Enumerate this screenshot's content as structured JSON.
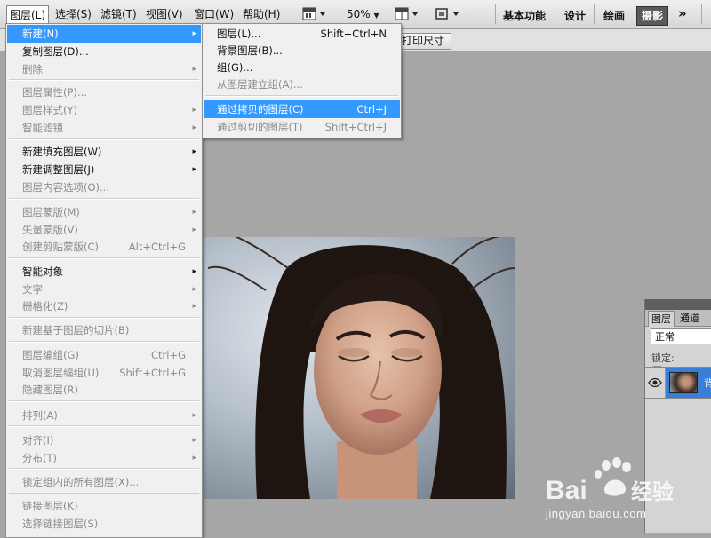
{
  "menubar": {
    "items": [
      "图层(L)",
      "选择(S)",
      "滤镜(T)",
      "视图(V)",
      "窗口(W)",
      "帮助(H)"
    ],
    "zoom": "50%",
    "workspaces": [
      "基本功能",
      "设计",
      "绘画",
      "摄影"
    ],
    "more": "»"
  },
  "optbar": {
    "print_size": "打印尺寸"
  },
  "layer_menu": {
    "items": [
      {
        "label": "新建(N)",
        "shortcut": "",
        "arrow": "▸"
      },
      {
        "label": "复制图层(D)...",
        "shortcut": "",
        "arrow": ""
      },
      {
        "label": "删除",
        "shortcut": "",
        "arrow": "▸"
      },
      {
        "label": "图层属性(P)...",
        "shortcut": "",
        "arrow": ""
      },
      {
        "label": "图层样式(Y)",
        "shortcut": "",
        "arrow": "▸"
      },
      {
        "label": "智能滤镜",
        "shortcut": "",
        "arrow": "▸"
      },
      {
        "label": "新建填充图层(W)",
        "shortcut": "",
        "arrow": "▸"
      },
      {
        "label": "新建调整图层(J)",
        "shortcut": "",
        "arrow": "▸"
      },
      {
        "label": "图层内容选项(O)...",
        "shortcut": "",
        "arrow": ""
      },
      {
        "label": "图层蒙版(M)",
        "shortcut": "",
        "arrow": "▸"
      },
      {
        "label": "矢量蒙版(V)",
        "shortcut": "",
        "arrow": "▸"
      },
      {
        "label": "创建剪贴蒙版(C)",
        "shortcut": "Alt+Ctrl+G",
        "arrow": ""
      },
      {
        "label": "智能对象",
        "shortcut": "",
        "arrow": "▸"
      },
      {
        "label": "文字",
        "shortcut": "",
        "arrow": "▸"
      },
      {
        "label": "栅格化(Z)",
        "shortcut": "",
        "arrow": "▸"
      },
      {
        "label": "新建基于图层的切片(B)",
        "shortcut": "",
        "arrow": ""
      },
      {
        "label": "图层编组(G)",
        "shortcut": "Ctrl+G",
        "arrow": ""
      },
      {
        "label": "取消图层编组(U)",
        "shortcut": "Shift+Ctrl+G",
        "arrow": ""
      },
      {
        "label": "隐藏图层(R)",
        "shortcut": "",
        "arrow": ""
      },
      {
        "label": "排列(A)",
        "shortcut": "",
        "arrow": "▸"
      },
      {
        "label": "对齐(I)",
        "shortcut": "",
        "arrow": "▸"
      },
      {
        "label": "分布(T)",
        "shortcut": "",
        "arrow": "▸"
      },
      {
        "label": "锁定组内的所有图层(X)...",
        "shortcut": "",
        "arrow": ""
      },
      {
        "label": "链接图层(K)",
        "shortcut": "",
        "arrow": ""
      },
      {
        "label": "选择链接图层(S)",
        "shortcut": "",
        "arrow": ""
      }
    ]
  },
  "new_submenu": {
    "items": [
      {
        "label": "图层(L)...",
        "shortcut": "Shift+Ctrl+N"
      },
      {
        "label": "背景图层(B)...",
        "shortcut": ""
      },
      {
        "label": "组(G)...",
        "shortcut": ""
      },
      {
        "label": "从图层建立组(A)...",
        "shortcut": ""
      },
      {
        "label": "通过拷贝的图层(C)",
        "shortcut": "Ctrl+J"
      },
      {
        "label": "通过剪切的图层(T)",
        "shortcut": "Shift+Ctrl+J"
      }
    ]
  },
  "layers_panel": {
    "tabs": [
      "图层",
      "通道"
    ],
    "blend_mode": "正常",
    "lock_label": "锁定:",
    "layer_name": "背"
  },
  "watermark": {
    "text": "Bai 经验",
    "url": "jingyan.baidu.com"
  },
  "colors": {
    "highlight": "#3399ff",
    "menu_bg": "#f0f0f0",
    "canvas_bg": "#a6a6a6",
    "layer_selected": "#3a7ed8"
  }
}
